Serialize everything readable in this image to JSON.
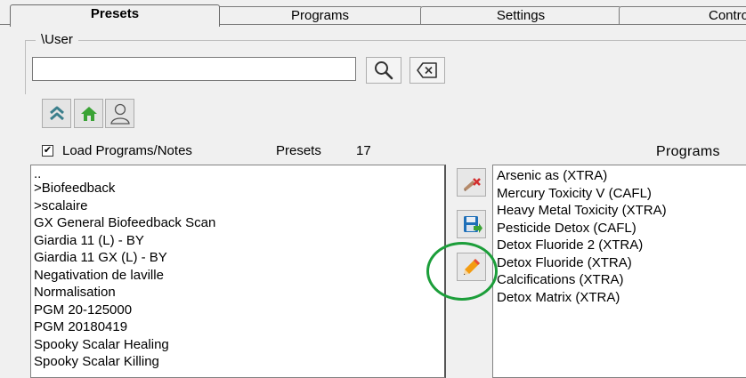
{
  "tabs": [
    {
      "label": "Presets",
      "active": true
    },
    {
      "label": "Programs",
      "active": false
    },
    {
      "label": "Settings",
      "active": false
    },
    {
      "label": "Contro",
      "active": false
    }
  ],
  "path": {
    "label": "\\User"
  },
  "search": {
    "value": "",
    "placeholder": ""
  },
  "buttons": {
    "search_icon": "search-icon",
    "clear_icon": "backspace-icon",
    "up_icon": "double-chevron-up-icon",
    "home_icon": "home-icon",
    "user_icon": "user-icon"
  },
  "options": {
    "load_programs_notes": {
      "label": "Load Programs/Notes",
      "checked": true,
      "mark": "✔"
    }
  },
  "presets": {
    "label": "Presets",
    "count": "17",
    "items": [
      "..",
      ">Biofeedback",
      ">scalaire",
      "GX General Biofeedback Scan",
      "Giardia 11 (L) - BY",
      "Giardia 11 GX (L) - BY",
      "Negativation de laville",
      "Normalisation",
      "PGM 20-125000",
      "PGM 20180419",
      "Spooky Scalar Healing",
      "Spooky Scalar Killing"
    ]
  },
  "programs": {
    "label": "Programs",
    "items": [
      "Arsenic as (XTRA)",
      "Mercury Toxicity V (CAFL)",
      "Heavy Metal Toxicity (XTRA)",
      "Pesticide Detox (CAFL)",
      "Detox Fluoride 2 (XTRA)",
      "Detox Fluoride (XTRA)",
      "Calcifications (XTRA)",
      "Detox Matrix (XTRA)"
    ]
  },
  "side_buttons": [
    "delete-preset-icon",
    "save-preset-icon",
    "edit-preset-icon"
  ],
  "colors": {
    "highlight": "#1c9e3a",
    "home_green": "#3aa335"
  }
}
